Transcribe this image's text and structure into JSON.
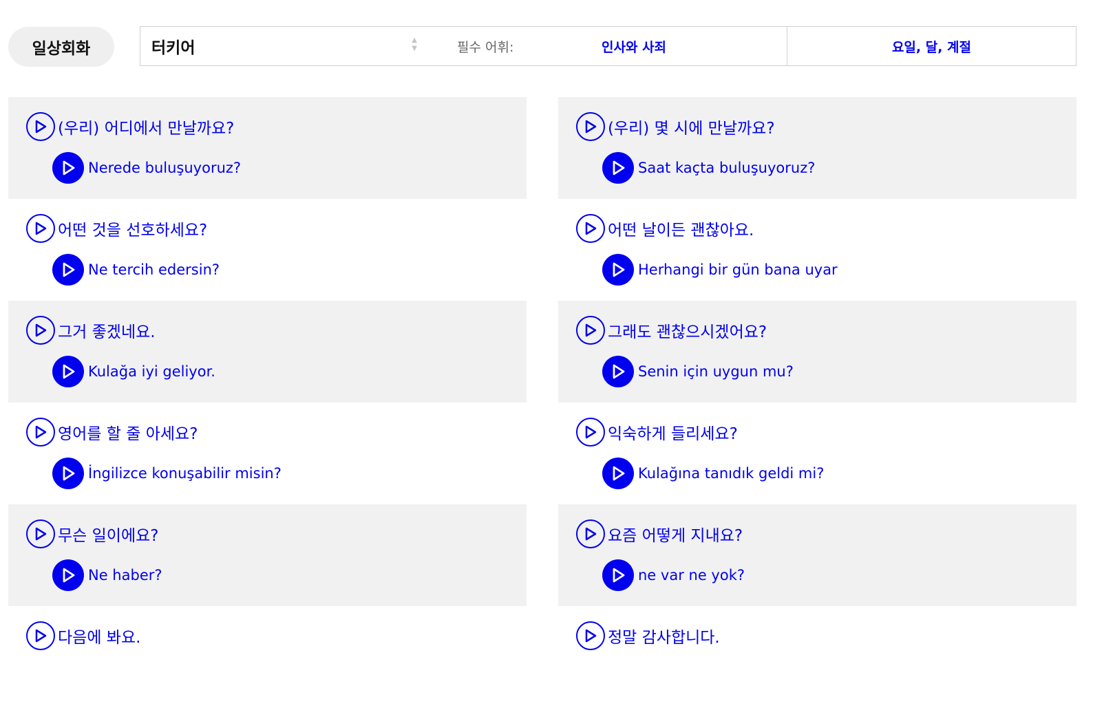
{
  "header": {
    "category_label": "일상회화",
    "language_selected": "터키어",
    "vocab_label": "필수 어휘:",
    "vocab_links": [
      "인사와 사죄",
      "요일, 달, 계절"
    ]
  },
  "phrases_left": [
    {
      "ko": "(우리) 어디에서 만날까요?",
      "tr": "Nerede buluşuyoruz?"
    },
    {
      "ko": "어떤 것을 선호하세요?",
      "tr": "Ne tercih edersin?"
    },
    {
      "ko": "그거 좋겠네요.",
      "tr": "Kulağa iyi geliyor."
    },
    {
      "ko": "영어를 할 줄 아세요?",
      "tr": "İngilizce konuşabilir misin?"
    },
    {
      "ko": "무슨 일이에요?",
      "tr": "Ne haber?"
    },
    {
      "ko": "다음에 봐요.",
      "tr": ""
    }
  ],
  "phrases_right": [
    {
      "ko": "(우리) 몇 시에 만날까요?",
      "tr": "Saat kaçta buluşuyoruz?"
    },
    {
      "ko": "어떤 날이든 괜찮아요.",
      "tr": "Herhangi bir gün bana uyar"
    },
    {
      "ko": "그래도 괜찮으시겠어요?",
      "tr": "Senin için uygun mu?"
    },
    {
      "ko": "익숙하게 들리세요?",
      "tr": "Kulağına tanıdık geldi mi?"
    },
    {
      "ko": "요즘 어떻게 지내요?",
      "tr": "ne var ne yok?"
    },
    {
      "ko": "정말 감사합니다.",
      "tr": ""
    }
  ],
  "colors": {
    "accent": "#0000ee",
    "card_bg": "#f1f1f1",
    "pill_bg": "#efefef"
  },
  "icons": {
    "outline_play": "play-outline-icon",
    "filled_play": "play-filled-icon"
  }
}
